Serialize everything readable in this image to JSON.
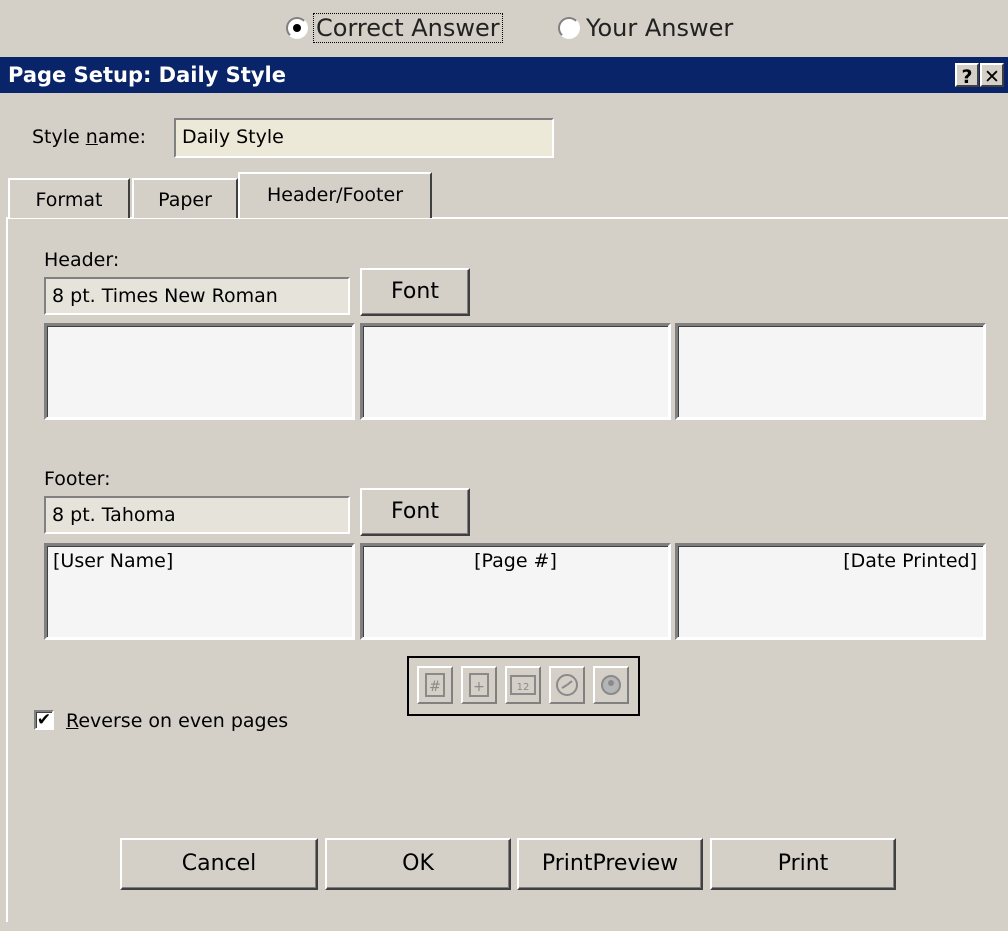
{
  "answer_toggle": {
    "correct_label": "Correct Answer",
    "yours_label": "Your Answer",
    "selected": "Correct Answer"
  },
  "dialog": {
    "title": "Page Setup: Daily Style",
    "help_glyph": "?",
    "close_glyph": "✕"
  },
  "style_name": {
    "label_pre": "Style ",
    "label_accel": "n",
    "label_post": "ame:",
    "value": "Daily Style"
  },
  "tabs": [
    {
      "label": "Format"
    },
    {
      "label": "Paper"
    },
    {
      "label": "Header/Footer"
    }
  ],
  "header": {
    "label": "Header:",
    "font_value": "8 pt. Times New Roman",
    "font_button": "Font",
    "left": "",
    "center": "",
    "right": ""
  },
  "footer": {
    "label": "Footer:",
    "font_value": "8 pt. Tahoma",
    "font_button": "Font",
    "left": "[User Name]",
    "center": "[Page #]",
    "right": "[Date Printed]"
  },
  "toolbar_icons": [
    "page-number-icon",
    "total-pages-icon",
    "date-printed-icon",
    "time-printed-icon",
    "user-name-icon"
  ],
  "reverse_even": {
    "checked": true,
    "check_glyph": "✔",
    "label_accel": "R",
    "label_rest": "everse on even pages"
  },
  "buttons": {
    "cancel": "Cancel",
    "ok": "OK",
    "preview": "PrintPreview",
    "print": "Print"
  }
}
